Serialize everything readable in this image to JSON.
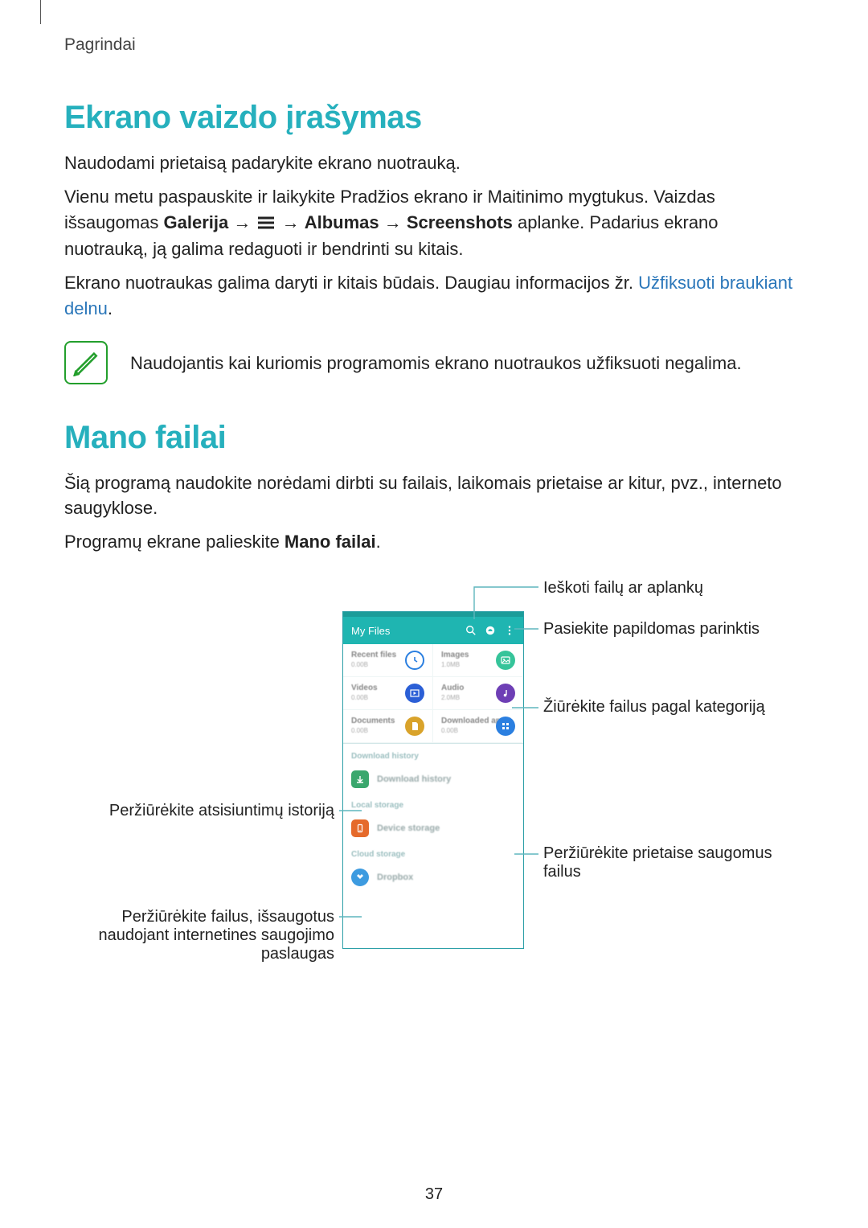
{
  "breadcrumb": "Pagrindai",
  "section1": {
    "heading": "Ekrano vaizdo įrašymas",
    "para1": "Naudodami prietaisą padarykite ekrano nuotrauką.",
    "para2_pre": "Vienu metu paspauskite ir laikykite Pradžios ekrano ir Maitinimo mygtukus. Vaizdas išsaugomas ",
    "para2_b1": "Galerija",
    "para2_arrow": " → ",
    "para2_b2": "Albumas",
    "para2_b3": "Screenshots",
    "para2_post": " aplanke. Padarius ekrano nuotrauką, ją galima redaguoti ir bendrinti su kitais.",
    "para3_pre": "Ekrano nuotraukas galima daryti ir kitais būdais. Daugiau informacijos žr. ",
    "para3_link": "Užfiksuoti braukiant delnu",
    "para3_post": ".",
    "note": "Naudojantis kai kuriomis programomis ekrano nuotraukos užfiksuoti negalima."
  },
  "section2": {
    "heading": "Mano failai",
    "para1": "Šią programą naudokite norėdami dirbti su failais, laikomais prietaise ar kitur, pvz., interneto saugyklose.",
    "para2_pre": "Programų ekrane palieskite ",
    "para2_bold": "Mano failai",
    "para2_post": "."
  },
  "phone": {
    "title": "My Files",
    "tiles": {
      "recent": {
        "label": "Recent files",
        "sub": "0.00B"
      },
      "images": {
        "label": "Images",
        "sub": "1.0MB"
      },
      "videos": {
        "label": "Videos",
        "sub": "0.00B"
      },
      "audio": {
        "label": "Audio",
        "sub": "2.0MB"
      },
      "docs": {
        "label": "Documents",
        "sub": "0.00B"
      },
      "dlapps": {
        "label": "Downloaded apps",
        "sub": "0.00B"
      }
    },
    "sections": {
      "dlhist": "Download history",
      "dlhist_row": "Download history",
      "local": "Local storage",
      "local_row": "Device storage",
      "cloud": "Cloud storage",
      "cloud_row": "Dropbox"
    }
  },
  "callouts": {
    "c_search": "Ieškoti failų ar aplankų",
    "c_options": "Pasiekite papildomas parinktis",
    "c_category": "Žiūrėkite failus pagal kategoriją",
    "c_dlhist": "Peržiūrėkite atsisiuntimų istoriją",
    "c_device": "Peržiūrėkite prietaise saugomus failus",
    "c_cloud": "Peržiūrėkite failus, išsaugotus naudojant internetines saugojimo paslaugas"
  },
  "page_number": "37"
}
